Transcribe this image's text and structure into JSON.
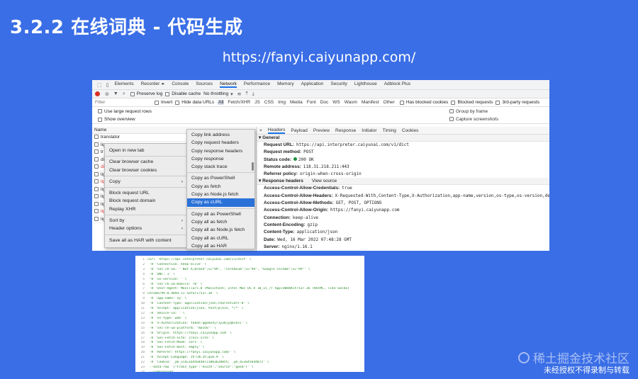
{
  "slide": {
    "title": "3.2.2 在线词典 - 代码生成",
    "url": "https://fanyi.caiyunapp.com/"
  },
  "devtools": {
    "panel_tabs": [
      "Elements",
      "Recorder ⏶",
      "Console",
      "Sources",
      "Network",
      "Performance",
      "Memory",
      "Application",
      "Security",
      "Lighthouse",
      "Adblock Plus"
    ],
    "active_panel": "Network",
    "toolbar": {
      "preserve_log": "Preserve log",
      "disable_cache": "Disable cache",
      "throttling": "No throttling"
    },
    "filter": {
      "placeholder": "Filter",
      "invert": "Invert",
      "hide_data_urls": "Hide data URLs",
      "types": [
        "All",
        "Fetch/XHR",
        "JS",
        "CSS",
        "Img",
        "Media",
        "Font",
        "Doc",
        "WS",
        "Wasm",
        "Manifest",
        "Other"
      ],
      "has_blocked_cookies": "Has blocked cookies",
      "blocked_requests": "Blocked requests",
      "third_party": "3rd-party requests"
    },
    "options": {
      "large_rows": "Use large request rows",
      "group_by_frame": "Group by frame",
      "show_overview": "Show overview",
      "capture_screenshots": "Capture screenshots"
    },
    "name_header": "Name",
    "requests": [
      {
        "name": "translator",
        "error": false
      },
      {
        "name": "lig",
        "error": false
      },
      {
        "name": "tr",
        "error": false
      },
      {
        "name": "di",
        "error": false
      },
      {
        "name": "di",
        "error": true
      },
      {
        "name": "lig",
        "error": false
      },
      {
        "name": "lig",
        "error": true
      },
      {
        "name": "lig",
        "error": false
      },
      {
        "name": "lig",
        "error": false
      },
      {
        "name": "lig",
        "error": false
      },
      {
        "name": "lig",
        "error": true
      },
      {
        "name": "lig",
        "error": false
      }
    ],
    "context_menu": [
      {
        "label": "Open in new tab"
      },
      {
        "sep": true
      },
      {
        "label": "Clear browser cache"
      },
      {
        "label": "Clear browser cookies"
      },
      {
        "sep": true
      },
      {
        "label": "Copy",
        "sub": true,
        "highlight": false
      },
      {
        "sep": true
      },
      {
        "label": "Block request URL"
      },
      {
        "label": "Block request domain"
      },
      {
        "label": "Replay XHR"
      },
      {
        "sep": true
      },
      {
        "label": "Sort by",
        "sub": true
      },
      {
        "label": "Header options",
        "sub": true
      },
      {
        "sep": true
      },
      {
        "label": "Save all as HAR with content"
      }
    ],
    "copy_submenu": [
      "Copy link address",
      "Copy request headers",
      "Copy response headers",
      "Copy response",
      "Copy stack trace",
      "Copy as PowerShell",
      "Copy as fetch",
      "Copy as Node.js fetch",
      "Copy as cURL",
      "Copy all as PowerShell",
      "Copy all as fetch",
      "Copy all as Node.js fetch",
      "Copy all as cURL",
      "Copy all as HAR"
    ],
    "copy_submenu_highlight": "Copy as cURL",
    "detail_tabs": [
      "×",
      "Headers",
      "Payload",
      "Preview",
      "Response",
      "Initiator",
      "Timing",
      "Cookies"
    ],
    "general_label": "▾ General",
    "general": [
      {
        "k": "Request URL:",
        "v": "https://api.interpreter.caiyunai.com/v1/dict"
      },
      {
        "k": "Request method:",
        "v": "POST"
      },
      {
        "k": "Status code:",
        "v": "200 OK",
        "status": true
      },
      {
        "k": "Remote address:",
        "v": "118.31.218.211:443"
      },
      {
        "k": "Referrer policy:",
        "v": "origin-when-cross-origin"
      }
    ],
    "response_headers_label": "▾ Response headers",
    "view_source": "View source",
    "response_headers": [
      {
        "k": "Access-Control-Allow-Credentials:",
        "v": "true"
      },
      {
        "k": "Access-Control-Allow-Headers:",
        "v": "X-Requested-With,Content-Type,X-Authorization,app-name,version,os-type,os-version,device-id"
      },
      {
        "k": "Access-Control-Allow-Methods:",
        "v": "GET, POST, OPTIONS"
      },
      {
        "k": "Access-Control-Allow-Origin:",
        "v": "https://fanyi.caiyunapp.com"
      },
      {
        "k": "Connection:",
        "v": "keep-alive"
      },
      {
        "k": "Content-Encoding:",
        "v": "gzip"
      },
      {
        "k": "Content-Type:",
        "v": "application/json"
      },
      {
        "k": "Date:",
        "v": "Wed, 16 Mar 2022 07:48:28 GMT"
      },
      {
        "k": "Server:",
        "v": "nginx/1.16.1"
      }
    ]
  },
  "curl_code": [
    "curl 'https://api.interpreter.caiyunai.com/v1/dict' \\",
    "  -H 'Connection: keep-alive' \\",
    "  -H 'sec-ch-ua: \" Not A;Brand\";v=\"99\", \"Chromium\";v=\"99\", \"Google Chrome\";v=\"99\"' \\",
    "  -H 'DNT: 1' \\",
    "  -H 'os-version: ' \\",
    "  -H 'sec-ch-ua-mobile: ?0' \\",
    "  -H 'User-Agent: Mozilla/5.0 (Macintosh; Intel Mac OS X 10_15_7) AppleWebKit/537.36 (KHTML, like Gecko)",
    "Chrome/99.0.4844.51 Safari/537.36' \\",
    "  -H 'app-name: xy' \\",
    "  -H 'Content-Type: application/json;charset=UTF-8' \\",
    "  -H 'Accept: application/json, text/plain, */*' \\",
    "  -H 'device-id: ' \\",
    "  -H 'os-type: web' \\",
    "  -H 'X-Authorization: token:qgemv4jr1y38jyq6vhvi' \\",
    "  -H 'sec-ch-ua-platform: \"macOS\"' \\",
    "  -H 'Origin: https://fanyi.caiyunapp.com' \\",
    "  -H 'Sec-Fetch-Site: cross-site' \\",
    "  -H 'Sec-Fetch-Mode: cors' \\",
    "  -H 'Sec-Fetch-Dest: empty' \\",
    "  -H 'Referer: https://fanyi.caiyunapp.com/' \\",
    "  -H 'Accept-Language: zh-CN,zh;q=0.9' \\",
    "  -H 'Cookie: _ym_uid=16456448721003620055; _ym_d=1645644872' \\",
    "  --data-raw '{\"trans_type\":\"en2zh\",\"source\":\"good\"}' \\",
    "  --compressed"
  ],
  "watermark": "稀土掘金技术社区",
  "notice": "未经授权不得录制与转载"
}
